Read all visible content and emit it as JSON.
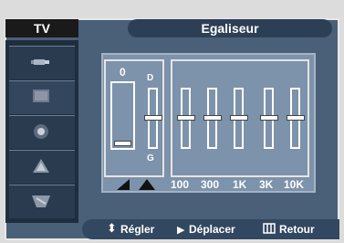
{
  "header": {
    "left_label": "TV",
    "title": "Egaliseur"
  },
  "sidebar": {
    "items": [
      {
        "icon": "plug-icon"
      },
      {
        "icon": "picture-icon",
        "active": true
      },
      {
        "icon": "speaker-icon"
      },
      {
        "icon": "channel-icon"
      },
      {
        "icon": "setup-icon"
      }
    ]
  },
  "equalizer": {
    "balance_value": "0",
    "balance_top_label": "D",
    "balance_bottom_label": "G",
    "bands": [
      "100",
      "300",
      "1K",
      "3K",
      "10K"
    ]
  },
  "footer": {
    "adjust_label": "Régler",
    "move_label": "Déplacer",
    "return_label": "Retour"
  }
}
